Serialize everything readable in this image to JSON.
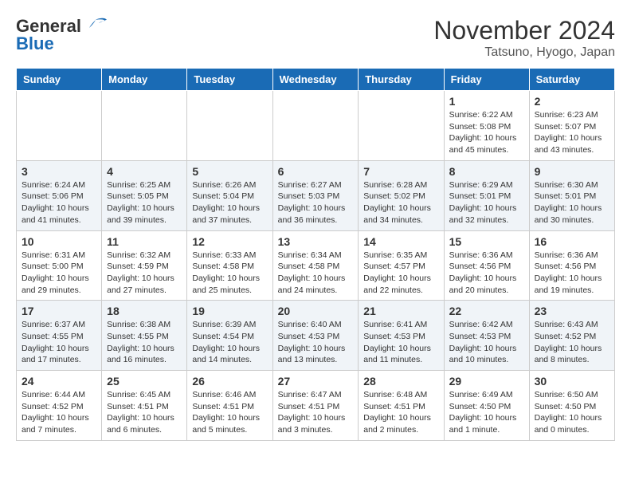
{
  "header": {
    "logo_general": "General",
    "logo_blue": "Blue",
    "month_title": "November 2024",
    "location": "Tatsuno, Hyogo, Japan"
  },
  "weekdays": [
    "Sunday",
    "Monday",
    "Tuesday",
    "Wednesday",
    "Thursday",
    "Friday",
    "Saturday"
  ],
  "weeks": [
    [
      {
        "day": "",
        "info": ""
      },
      {
        "day": "",
        "info": ""
      },
      {
        "day": "",
        "info": ""
      },
      {
        "day": "",
        "info": ""
      },
      {
        "day": "",
        "info": ""
      },
      {
        "day": "1",
        "info": "Sunrise: 6:22 AM\nSunset: 5:08 PM\nDaylight: 10 hours and 45 minutes."
      },
      {
        "day": "2",
        "info": "Sunrise: 6:23 AM\nSunset: 5:07 PM\nDaylight: 10 hours and 43 minutes."
      }
    ],
    [
      {
        "day": "3",
        "info": "Sunrise: 6:24 AM\nSunset: 5:06 PM\nDaylight: 10 hours and 41 minutes."
      },
      {
        "day": "4",
        "info": "Sunrise: 6:25 AM\nSunset: 5:05 PM\nDaylight: 10 hours and 39 minutes."
      },
      {
        "day": "5",
        "info": "Sunrise: 6:26 AM\nSunset: 5:04 PM\nDaylight: 10 hours and 37 minutes."
      },
      {
        "day": "6",
        "info": "Sunrise: 6:27 AM\nSunset: 5:03 PM\nDaylight: 10 hours and 36 minutes."
      },
      {
        "day": "7",
        "info": "Sunrise: 6:28 AM\nSunset: 5:02 PM\nDaylight: 10 hours and 34 minutes."
      },
      {
        "day": "8",
        "info": "Sunrise: 6:29 AM\nSunset: 5:01 PM\nDaylight: 10 hours and 32 minutes."
      },
      {
        "day": "9",
        "info": "Sunrise: 6:30 AM\nSunset: 5:01 PM\nDaylight: 10 hours and 30 minutes."
      }
    ],
    [
      {
        "day": "10",
        "info": "Sunrise: 6:31 AM\nSunset: 5:00 PM\nDaylight: 10 hours and 29 minutes."
      },
      {
        "day": "11",
        "info": "Sunrise: 6:32 AM\nSunset: 4:59 PM\nDaylight: 10 hours and 27 minutes."
      },
      {
        "day": "12",
        "info": "Sunrise: 6:33 AM\nSunset: 4:58 PM\nDaylight: 10 hours and 25 minutes."
      },
      {
        "day": "13",
        "info": "Sunrise: 6:34 AM\nSunset: 4:58 PM\nDaylight: 10 hours and 24 minutes."
      },
      {
        "day": "14",
        "info": "Sunrise: 6:35 AM\nSunset: 4:57 PM\nDaylight: 10 hours and 22 minutes."
      },
      {
        "day": "15",
        "info": "Sunrise: 6:36 AM\nSunset: 4:56 PM\nDaylight: 10 hours and 20 minutes."
      },
      {
        "day": "16",
        "info": "Sunrise: 6:36 AM\nSunset: 4:56 PM\nDaylight: 10 hours and 19 minutes."
      }
    ],
    [
      {
        "day": "17",
        "info": "Sunrise: 6:37 AM\nSunset: 4:55 PM\nDaylight: 10 hours and 17 minutes."
      },
      {
        "day": "18",
        "info": "Sunrise: 6:38 AM\nSunset: 4:55 PM\nDaylight: 10 hours and 16 minutes."
      },
      {
        "day": "19",
        "info": "Sunrise: 6:39 AM\nSunset: 4:54 PM\nDaylight: 10 hours and 14 minutes."
      },
      {
        "day": "20",
        "info": "Sunrise: 6:40 AM\nSunset: 4:53 PM\nDaylight: 10 hours and 13 minutes."
      },
      {
        "day": "21",
        "info": "Sunrise: 6:41 AM\nSunset: 4:53 PM\nDaylight: 10 hours and 11 minutes."
      },
      {
        "day": "22",
        "info": "Sunrise: 6:42 AM\nSunset: 4:53 PM\nDaylight: 10 hours and 10 minutes."
      },
      {
        "day": "23",
        "info": "Sunrise: 6:43 AM\nSunset: 4:52 PM\nDaylight: 10 hours and 8 minutes."
      }
    ],
    [
      {
        "day": "24",
        "info": "Sunrise: 6:44 AM\nSunset: 4:52 PM\nDaylight: 10 hours and 7 minutes."
      },
      {
        "day": "25",
        "info": "Sunrise: 6:45 AM\nSunset: 4:51 PM\nDaylight: 10 hours and 6 minutes."
      },
      {
        "day": "26",
        "info": "Sunrise: 6:46 AM\nSunset: 4:51 PM\nDaylight: 10 hours and 5 minutes."
      },
      {
        "day": "27",
        "info": "Sunrise: 6:47 AM\nSunset: 4:51 PM\nDaylight: 10 hours and 3 minutes."
      },
      {
        "day": "28",
        "info": "Sunrise: 6:48 AM\nSunset: 4:51 PM\nDaylight: 10 hours and 2 minutes."
      },
      {
        "day": "29",
        "info": "Sunrise: 6:49 AM\nSunset: 4:50 PM\nDaylight: 10 hours and 1 minute."
      },
      {
        "day": "30",
        "info": "Sunrise: 6:50 AM\nSunset: 4:50 PM\nDaylight: 10 hours and 0 minutes."
      }
    ]
  ]
}
